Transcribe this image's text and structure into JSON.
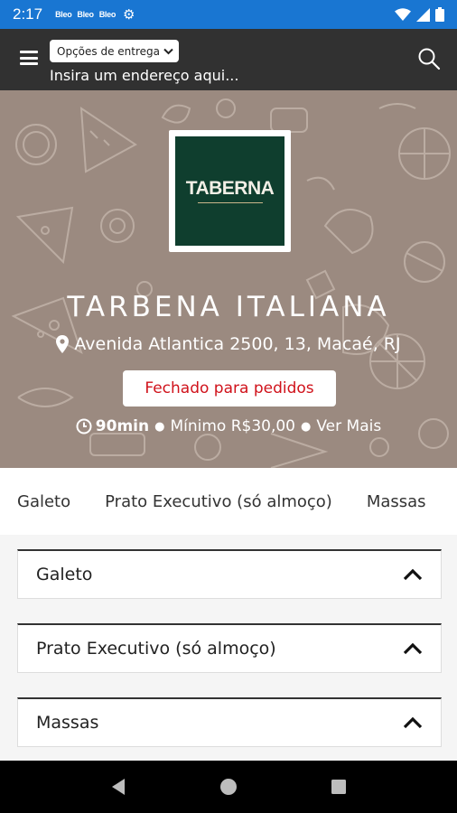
{
  "status_bar": {
    "time": "2:17",
    "notifications": [
      "Bleo",
      "Bleo",
      "Bleo"
    ]
  },
  "header": {
    "delivery_options_label": "Opções de entrega",
    "address_placeholder": "Insira um endereço aqui..."
  },
  "restaurant": {
    "logo_text": "TABERNA",
    "name": "TARBENA ITALIANA",
    "address": "Avenida Atlantica 2500, 13, Macaé, RJ",
    "status": "Fechado para pedidos",
    "delivery_time": "90min",
    "minimum": "Mínimo R$30,00",
    "more_link": "Ver Mais"
  },
  "tabs": [
    {
      "label": "Galeto"
    },
    {
      "label": "Prato Executivo (só almoço)"
    },
    {
      "label": "Massas"
    }
  ],
  "sections": [
    {
      "title": "Galeto"
    },
    {
      "title": "Prato Executivo (só almoço)"
    },
    {
      "title": "Massas"
    }
  ],
  "colors": {
    "status_bar": "#1976d2",
    "app_bar": "#313131",
    "hero_bg": "#9b8a80",
    "logo_bg": "#0f3e2e",
    "closed_text": "#d0121b"
  }
}
